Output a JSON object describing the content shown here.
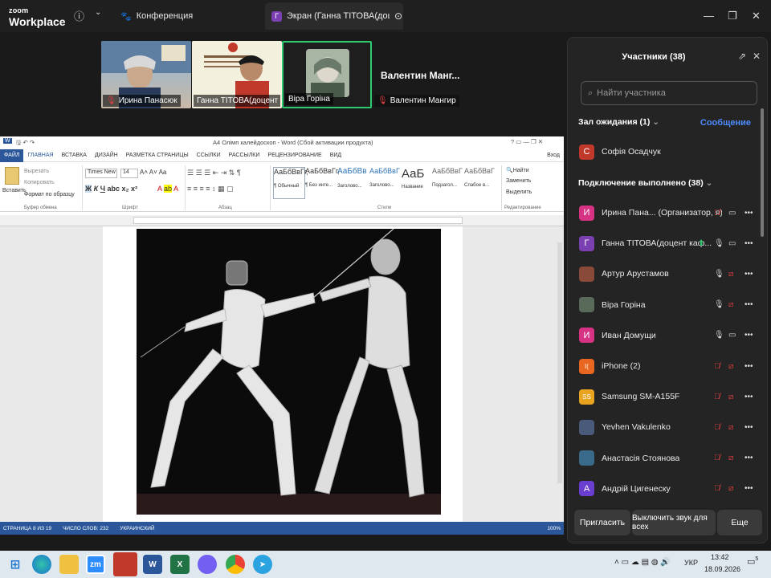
{
  "app": {
    "logo_top": "zoom",
    "logo_bottom": "Workplace"
  },
  "tabs": {
    "meeting_label": "Конференция",
    "screen_avatar": "Г",
    "screen_label": "Экран (Ганна ТІТОВА(доцент каф"
  },
  "videos": [
    {
      "name": "Ирина Панасюк",
      "muted": true
    },
    {
      "name": "Ганна ТІТОВА(доцент ка...",
      "muted": false
    },
    {
      "name": "Віра Горіна",
      "muted": false
    },
    {
      "name": "Валентин Мангир",
      "muted": true
    }
  ],
  "active_speaker_name": "Валентин  Манг...",
  "word": {
    "title": "А4 Олімп калейдоскоп - Word (Сбой активации продукта)",
    "login": "Вход",
    "menu": [
      "ФАЙЛ",
      "ГЛАВНАЯ",
      "ВСТАВКА",
      "ДИЗАЙН",
      "РАЗМЕТКА СТРАНИЦЫ",
      "ССЫЛКИ",
      "РАССЫЛКИ",
      "РЕЦЕНЗИРОВАНИЕ",
      "ВИД"
    ],
    "clipboard": {
      "paste": "Вставить",
      "cut": "Вырезать",
      "copy": "Копировать",
      "format": "Формат по образцу",
      "group": "Буфер обмена"
    },
    "font": {
      "name": "Times New R",
      "size": "14",
      "group": "Шрифт"
    },
    "paragraph_group": "Абзац",
    "styles": [
      {
        "sample": "АаБбВвГг,",
        "name": "¶ Обычный"
      },
      {
        "sample": "АаБбВвГг,",
        "name": "¶ Без инте..."
      },
      {
        "sample": "АаБбВв",
        "name": "Заголово..."
      },
      {
        "sample": "АаБбВвГ",
        "name": "Заголово..."
      },
      {
        "sample": "АаБ",
        "name": "Название"
      },
      {
        "sample": "АаБбВвГ",
        "name": "Подзагол..."
      },
      {
        "sample": "АаБбВвГ",
        "name": "Слабое в..."
      }
    ],
    "styles_group": "Стили",
    "editing": {
      "find": "Найти",
      "replace": "Заменить",
      "select": "Выделить",
      "group": "Редактирование"
    },
    "status": {
      "page": "СТРАНИЦА 8 ИЗ 19",
      "words": "ЧИСЛО СЛОВ: 232",
      "lang": "УКРАИНСКИЙ",
      "zoom": "100%"
    }
  },
  "panel": {
    "title": "Участники (38)",
    "search_placeholder": "Найти участника",
    "waiting_label": "Зал ожидания (1)",
    "message_label": "Сообщение",
    "waiting": [
      {
        "initial": "С",
        "name": "Софія Осадчук",
        "color": "#c0392b"
      }
    ],
    "connected_label": "Подключение выполнено (38)",
    "participants": [
      {
        "initial": "И",
        "name": "Ирина Пана... (Организатор, я)",
        "color": "#d63384",
        "mic": "off",
        "cam": "on"
      },
      {
        "initial": "Г",
        "name": "Ганна ТІТОВА(доцент каф...",
        "color": "#7a3fb0",
        "mic": "on",
        "cam": "on",
        "share": true
      },
      {
        "initial": "",
        "name": "Артур Арустамов",
        "color": "#8a4a3a",
        "mic": "on",
        "cam": "off"
      },
      {
        "initial": "",
        "name": "Віра Горіна",
        "color": "#5a6a5a",
        "mic": "on",
        "cam": "off"
      },
      {
        "initial": "И",
        "name": "Иван Домущи",
        "color": "#d63384",
        "mic": "on",
        "cam": "on"
      },
      {
        "initial": "I(",
        "name": "iPhone (2)",
        "color": "#e8661f",
        "mic": "off",
        "cam": "off"
      },
      {
        "initial": "SS",
        "name": "Samsung SM-A155F",
        "color": "#e8a31f",
        "mic": "off",
        "cam": "off"
      },
      {
        "initial": "",
        "name": "Yevhen Vakulenko",
        "color": "#4a5a7a",
        "mic": "off",
        "cam": "off"
      },
      {
        "initial": "",
        "name": "Анастасія Стоянова",
        "color": "#3a6a8a",
        "mic": "off",
        "cam": "off"
      },
      {
        "initial": "А",
        "name": "Андрій Цигенеску",
        "color": "#6a3fd0",
        "mic": "off",
        "cam": "off"
      }
    ],
    "invite": "Пригласить",
    "mute_all": "Выключить звук для всех",
    "more": "Еще"
  },
  "taskbar": {
    "zoom_label": "zm",
    "lang": "УКР",
    "time": "13:42",
    "date": "18.09.2026",
    "notif": "5"
  }
}
